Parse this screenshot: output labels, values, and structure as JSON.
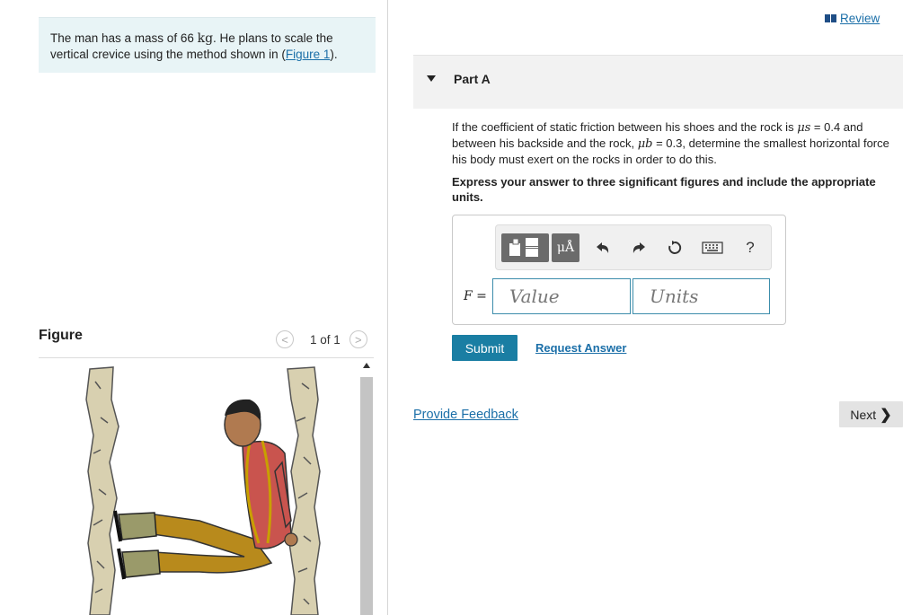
{
  "intro": {
    "text_before": "The man has a mass of 66 ",
    "mass_unit": "kg",
    "text_middle": ". He plans to scale the vertical crevice using the method shown in (",
    "figure_link": "Figure 1",
    "text_after": ")."
  },
  "figure_panel": {
    "label": "Figure",
    "count": "1 of 1",
    "prev_icon": "chevron-left-icon",
    "next_icon": "chevron-right-icon"
  },
  "review": {
    "label": "Review",
    "icon": "book-icon"
  },
  "part": {
    "title": "Part A"
  },
  "question": {
    "seg1": "If the coefficient of static friction between his shoes and the rock is ",
    "mu_s_symbol": "μs",
    "seg2": " = 0.4 and between his backside and the rock, ",
    "mu_b_symbol": "μb",
    "seg3": " = 0.3, determine the smallest horizontal force his body must exert on the rocks in order to do this."
  },
  "instruction": "Express your answer to three significant figures and include the appropriate units.",
  "toolbar": {
    "units_label": "μÅ",
    "undo_icon": "undo-arrow-icon",
    "redo_icon": "redo-arrow-icon",
    "reset_icon": "reset-icon",
    "keyboard_icon": "keyboard-icon",
    "help_label": "?"
  },
  "answer": {
    "variable": "F",
    "equals": " =",
    "value_placeholder": "Value",
    "units_placeholder": "Units"
  },
  "actions": {
    "submit_label": "Submit",
    "request_answer_label": "Request Answer",
    "feedback_label": "Provide Feedback",
    "next_label": "Next",
    "next_chevron": "❯"
  }
}
